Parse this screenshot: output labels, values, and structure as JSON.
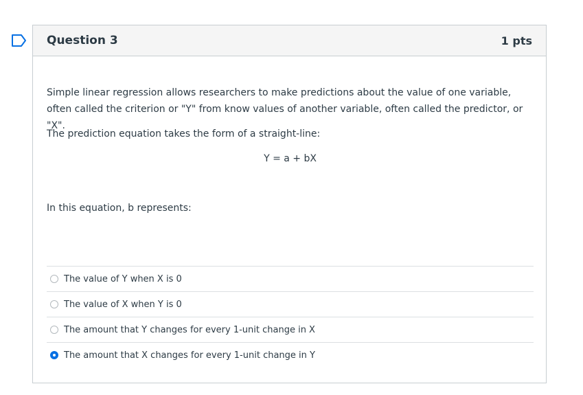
{
  "question": {
    "title": "Question 3",
    "points": "1 pts",
    "paragraph1": "Simple linear regression allows researchers to make predictions about the value of one variable, often called the criterion or \"Y\" from know values of another variable, often called the predictor, or \"X\".",
    "paragraph2": "The prediction equation takes the form of a straight-line:",
    "equation": "Y = a + bX",
    "prompt": "In this equation, b represents:"
  },
  "answers": [
    {
      "label": "The value of Y when X is 0",
      "selected": false
    },
    {
      "label": "The value of X when Y is 0",
      "selected": false
    },
    {
      "label": "The amount that Y changes for every 1-unit change in X",
      "selected": false
    },
    {
      "label": "The amount that X changes for every 1-unit change in Y",
      "selected": true
    }
  ],
  "colors": {
    "accent": "#0770e3",
    "flag": "#0770e3",
    "header_bg": "#f5f5f5",
    "border": "#c7cdd1"
  },
  "icons": {
    "flag": "bookmark-flag-icon"
  }
}
